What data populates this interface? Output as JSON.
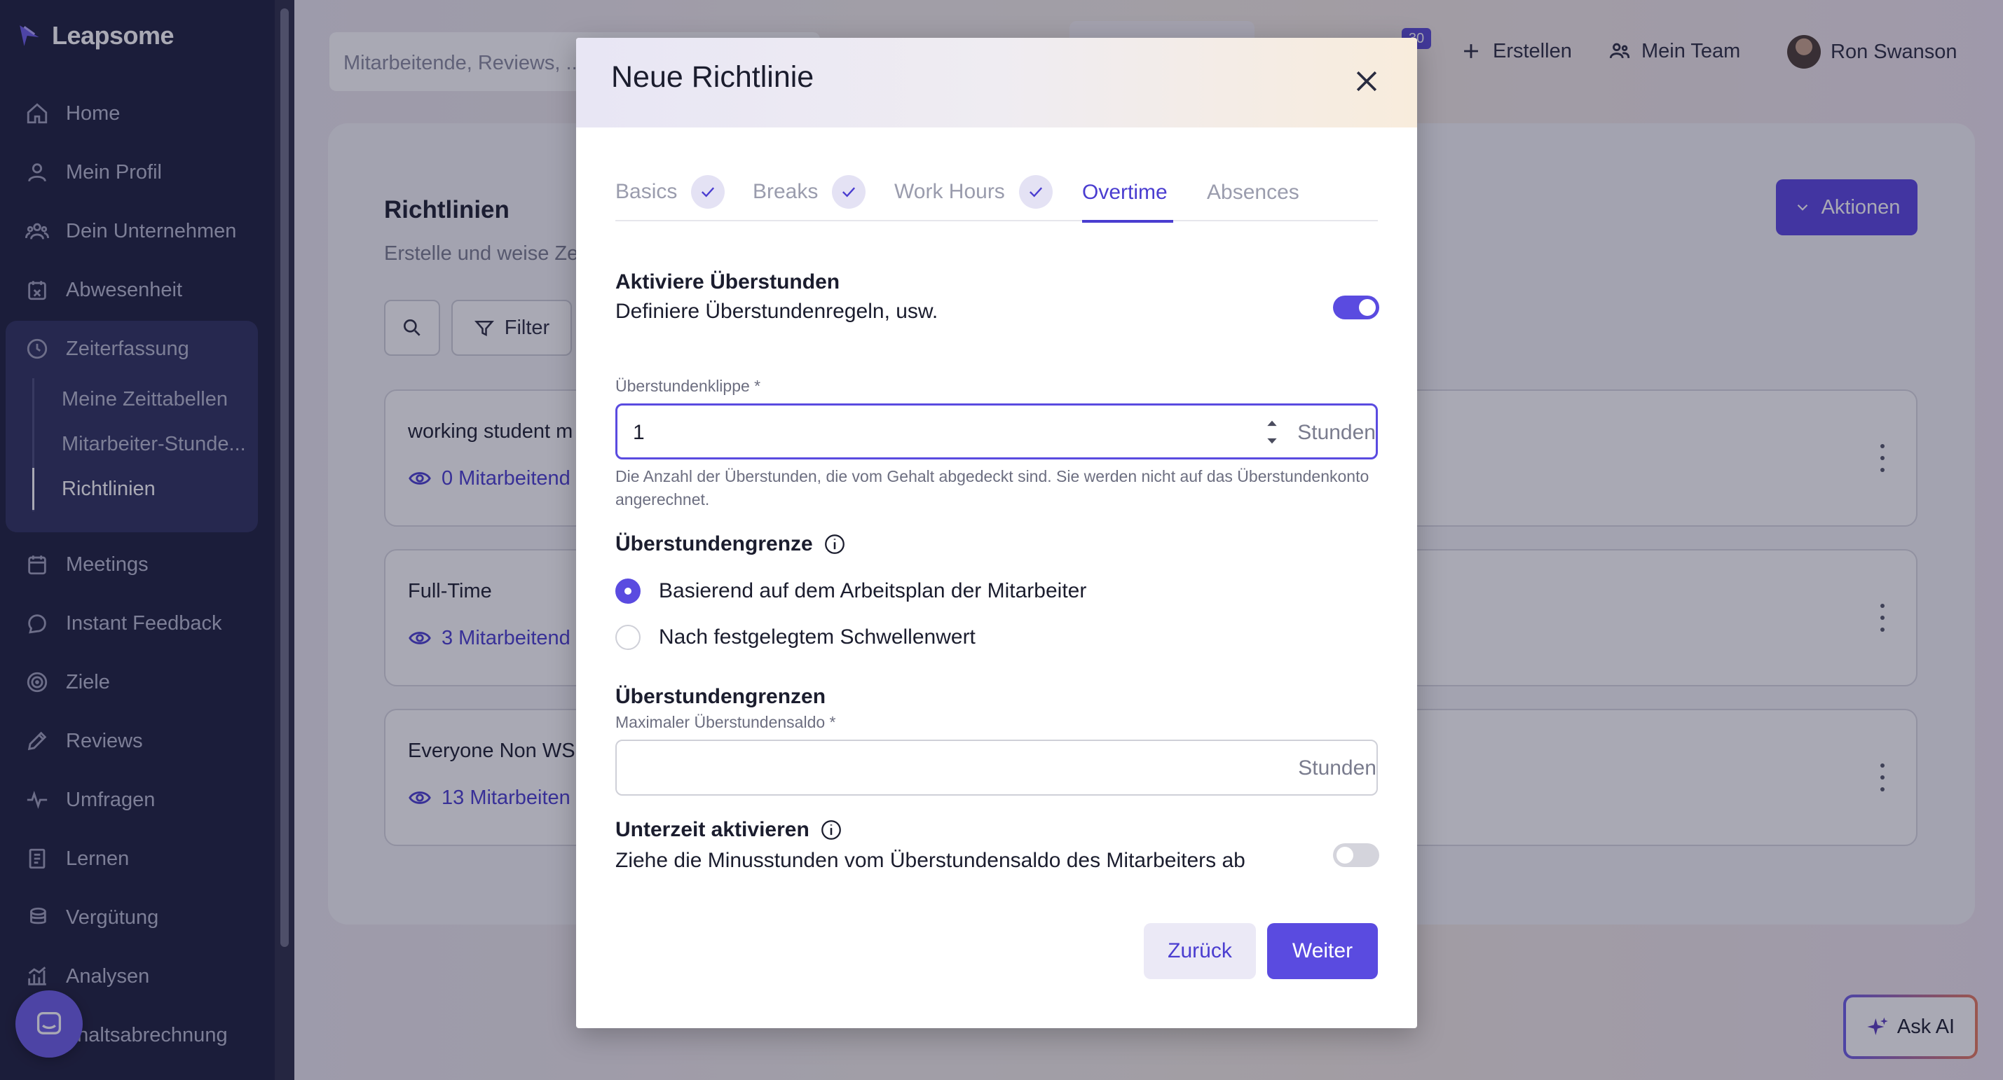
{
  "app": {
    "logo_text": "Leapsome"
  },
  "sidebar": {
    "items": [
      {
        "label": "Home",
        "icon": "home-icon"
      },
      {
        "label": "Mein Profil",
        "icon": "user-icon"
      },
      {
        "label": "Dein Unternehmen",
        "icon": "company-icon"
      },
      {
        "label": "Abwesenheit",
        "icon": "calendar-x-icon"
      },
      {
        "label": "Zeiterfassung",
        "icon": "clock-icon"
      },
      {
        "label": "Meetings",
        "icon": "calendar-icon"
      },
      {
        "label": "Instant Feedback",
        "icon": "chat-icon"
      },
      {
        "label": "Ziele",
        "icon": "target-icon"
      },
      {
        "label": "Reviews",
        "icon": "pencil-icon"
      },
      {
        "label": "Umfragen",
        "icon": "pulse-icon"
      },
      {
        "label": "Lernen",
        "icon": "book-icon"
      },
      {
        "label": "Vergütung",
        "icon": "coins-icon"
      },
      {
        "label": "Analysen",
        "icon": "chart-icon"
      },
      {
        "label": "ehaltsabrechnung",
        "icon": "payroll-icon"
      }
    ],
    "subitems": [
      {
        "label": "Meine Zeittabellen"
      },
      {
        "label": "Mitarbeiter-Stunde..."
      },
      {
        "label": "Richtlinien"
      }
    ]
  },
  "topbar": {
    "search_placeholder": "Mitarbeitende, Reviews, ...",
    "notification_count": "30",
    "create_label": "Erstellen",
    "team_label": "Mein Team",
    "user_name": "Ron Swanson"
  },
  "page": {
    "title": "Richtlinien",
    "subtitle": "Erstelle und weise Ze",
    "filter_label": "Filter",
    "actions_label": "Aktionen",
    "policies": [
      {
        "name": "working student m",
        "employees": "0 Mitarbeitend"
      },
      {
        "name": "Full-Time",
        "employees": "3 Mitarbeitend"
      },
      {
        "name": "Everyone Non WS",
        "employees": "13 Mitarbeiten"
      }
    ],
    "ask_ai_label": "Ask AI"
  },
  "modal": {
    "title": "Neue Richtlinie",
    "tabs": [
      {
        "label": "Basics",
        "done": true
      },
      {
        "label": "Breaks",
        "done": true
      },
      {
        "label": "Work Hours",
        "done": true
      },
      {
        "label": "Overtime",
        "done": false,
        "active": true
      },
      {
        "label": "Absences",
        "done": false
      }
    ],
    "activate": {
      "title": "Aktiviere Überstunden",
      "description": "Definiere Überstundenregeln, usw.",
      "enabled": true
    },
    "cliff": {
      "label": "Überstundenklippe *",
      "value": "1",
      "unit": "Stunden",
      "helper": "Die Anzahl der Überstunden, die vom Gehalt abgedeckt sind. Sie werden nicht auf das Überstundenkonto angerechnet."
    },
    "limit": {
      "title": "Überstundengrenze",
      "options": [
        {
          "label": "Basierend auf dem Arbeitsplan der Mitarbeiter",
          "selected": true
        },
        {
          "label": "Nach festgelegtem Schwellenwert",
          "selected": false
        }
      ]
    },
    "limits": {
      "title": "Überstundengrenzen",
      "max_label": "Maximaler Überstundensaldo *",
      "value": "",
      "unit": "Stunden"
    },
    "undertime": {
      "title": "Unterzeit aktivieren",
      "description": "Ziehe die Minusstunden vom Überstundensaldo des Mitarbeiters ab",
      "enabled": false
    },
    "back_label": "Zurück",
    "next_label": "Weiter"
  },
  "colors": {
    "accent": "#5a4be0",
    "sidebar_bg": "#1b1d3a",
    "link": "#4a3dd0"
  }
}
